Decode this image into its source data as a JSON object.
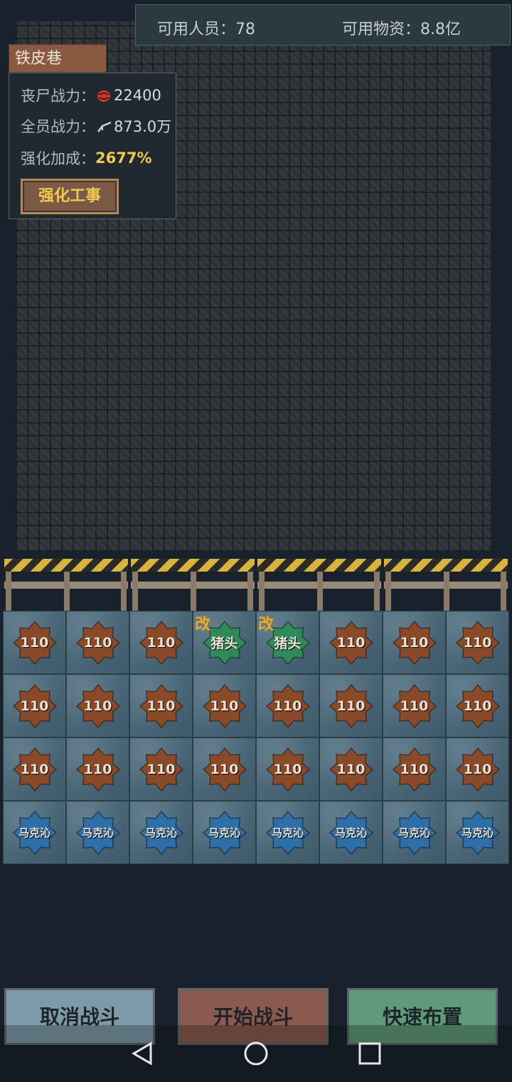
{
  "topbar": {
    "personnel_label": "可用人员：78",
    "supplies_label": "可用物资：8.8亿"
  },
  "location": {
    "name": "铁皮巷"
  },
  "info_panel": {
    "zombie_power_label": "丧尸战力：",
    "zombie_power_value": "22400",
    "team_power_label": "全员战力：",
    "team_power_value": "873.0万",
    "bonus_label": "强化加成：",
    "bonus_value": "2677%",
    "strengthen_button": "强化工事"
  },
  "grid": {
    "rows": [
      [
        {
          "label": "110",
          "type": "brown"
        },
        {
          "label": "110",
          "type": "brown"
        },
        {
          "label": "110",
          "type": "brown"
        },
        {
          "label": "猪头",
          "type": "green",
          "mod": "改"
        },
        {
          "label": "猪头",
          "type": "green",
          "mod": "改"
        },
        {
          "label": "110",
          "type": "brown"
        },
        {
          "label": "110",
          "type": "brown"
        },
        {
          "label": "110",
          "type": "brown"
        }
      ],
      [
        {
          "label": "110",
          "type": "brown"
        },
        {
          "label": "110",
          "type": "brown"
        },
        {
          "label": "110",
          "type": "brown"
        },
        {
          "label": "110",
          "type": "brown"
        },
        {
          "label": "110",
          "type": "brown"
        },
        {
          "label": "110",
          "type": "brown"
        },
        {
          "label": "110",
          "type": "brown"
        },
        {
          "label": "110",
          "type": "brown"
        }
      ],
      [
        {
          "label": "110",
          "type": "brown"
        },
        {
          "label": "110",
          "type": "brown"
        },
        {
          "label": "110",
          "type": "brown"
        },
        {
          "label": "110",
          "type": "brown"
        },
        {
          "label": "110",
          "type": "brown"
        },
        {
          "label": "110",
          "type": "brown"
        },
        {
          "label": "110",
          "type": "brown"
        },
        {
          "label": "110",
          "type": "brown"
        }
      ],
      [
        {
          "label": "马克沁",
          "type": "blue"
        },
        {
          "label": "马克沁",
          "type": "blue"
        },
        {
          "label": "马克沁",
          "type": "blue"
        },
        {
          "label": "马克沁",
          "type": "blue"
        },
        {
          "label": "马克沁",
          "type": "blue"
        },
        {
          "label": "马克沁",
          "type": "blue"
        },
        {
          "label": "马克沁",
          "type": "blue"
        },
        {
          "label": "马克沁",
          "type": "blue"
        }
      ]
    ]
  },
  "buttons": {
    "cancel": "取消战斗",
    "start": "开始战斗",
    "quick_deploy": "快速布置"
  },
  "colors": {
    "brown_unit": "#8a4a28",
    "green_unit": "#2f8a5a",
    "blue_unit": "#2d6fa8",
    "cancel_btn": "#7d9aa8",
    "start_btn": "#8a5a4e",
    "quick_btn": "#5f9a7a",
    "accent_gold": "#f2c94c"
  },
  "navigation": {
    "back_icon": "back-triangle-icon",
    "home_icon": "home-circle-icon",
    "recent_icon": "recent-square-icon"
  }
}
